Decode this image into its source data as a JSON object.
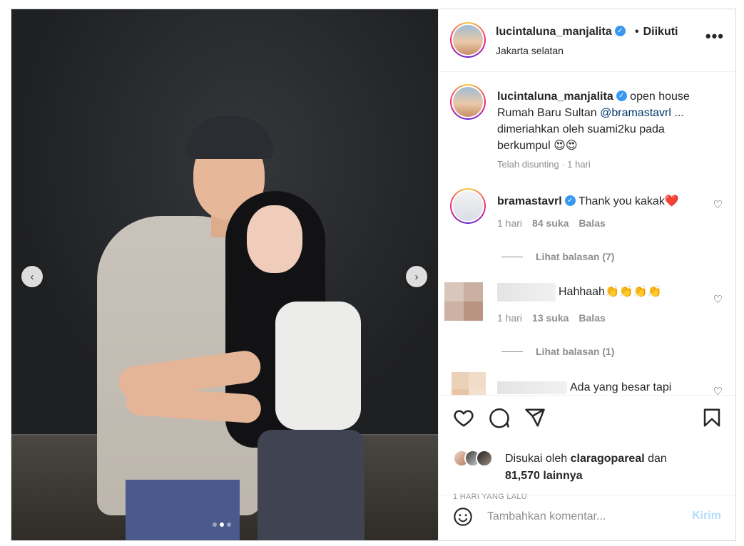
{
  "post": {
    "username": "lucintaluna_manjalita",
    "follow_status": "Diikuti",
    "follow_separator": "•",
    "location": "Jakarta selatan",
    "more_icon": "more-options-icon"
  },
  "caption": {
    "username": "lucintaluna_manjalita",
    "text_before": "open house Rumah Baru Sultan",
    "mention": "@bramastavrl",
    "text_after": "... dimeriahkan oleh suami2ku pada berkumpul 😍😍",
    "meta": "Telah disunting · 1 hari"
  },
  "comments": [
    {
      "username": "bramastavrl",
      "text": "Thank you kakak❤️",
      "time": "1 hari",
      "likes": "84 suka",
      "reply": "Balas",
      "view_replies": "Lihat balasan (7)"
    },
    {
      "username": "",
      "text": "Hahhaah👏👏👏👏",
      "time": "1 hari",
      "likes": "13 suka",
      "reply": "Balas",
      "view_replies": "Lihat balasan (1)"
    },
    {
      "username": "",
      "text": "Ada yang besar tapi"
    }
  ],
  "engagement": {
    "liked_by_prefix": "Disukai oleh",
    "liked_by_user": "claragopareal",
    "liked_by_and": "dan",
    "liked_by_rest": "81,570 lainnya",
    "time_ago": "1 HARI YANG LALU"
  },
  "composer": {
    "placeholder": "Tambahkan komentar...",
    "post_label": "Kirim"
  },
  "carousel": {
    "prev_glyph": "‹",
    "next_glyph": "›",
    "slide_count": 3,
    "active_slide": 2
  },
  "colors": {
    "verified": "#3897f0",
    "mention": "#00376b",
    "muted": "#8e8e8e",
    "post_disabled": "#b2dffc"
  }
}
